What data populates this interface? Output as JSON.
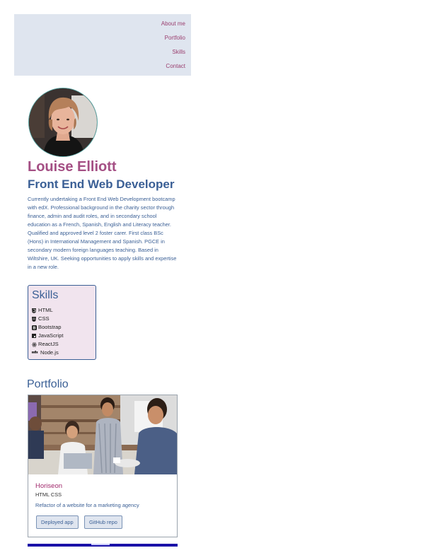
{
  "nav": {
    "links": [
      "About me",
      "Portfolio",
      "Skills",
      "Contact"
    ]
  },
  "profile": {
    "name": "Louise Elliott",
    "role": "Front End Web Developer",
    "bio": "Currently undertaking a Front End Web Development bootcamp with edX. Professional background in the charity sector through finance, admin and audit roles, and in secondary school education as a French, Spanish, English and Literacy teacher. Qualified and approved level 2 foster carer. First class BSc (Hons) in International Management and Spanish. PGCE in secondary modern foreign languages teaching. Based in Wiltshire, UK. Seeking opportunities to apply skills and expertise in a new role."
  },
  "skills": {
    "title": "Skills",
    "items": [
      {
        "label": "HTML",
        "icon": "html5-icon"
      },
      {
        "label": "CSS",
        "icon": "css3-icon"
      },
      {
        "label": "Bootstrap",
        "icon": "bootstrap-icon"
      },
      {
        "label": "JavaScript",
        "icon": "javascript-icon"
      },
      {
        "label": "ReactJS",
        "icon": "react-icon"
      },
      {
        "label": "Node.js",
        "icon": "nodejs-icon"
      }
    ]
  },
  "portfolio": {
    "heading": "Portfolio",
    "card": {
      "title": "Horiseon",
      "tech": "HTML CSS",
      "description": "Refactor of a website for a marketing agency",
      "buttons": [
        "Deployed app",
        "GitHub repo"
      ]
    }
  },
  "colors": {
    "accent_pink": "#a44f84",
    "accent_blue": "#3a5f95",
    "nav_bg": "#dfe5ef",
    "skills_bg": "#f1e4ee"
  }
}
